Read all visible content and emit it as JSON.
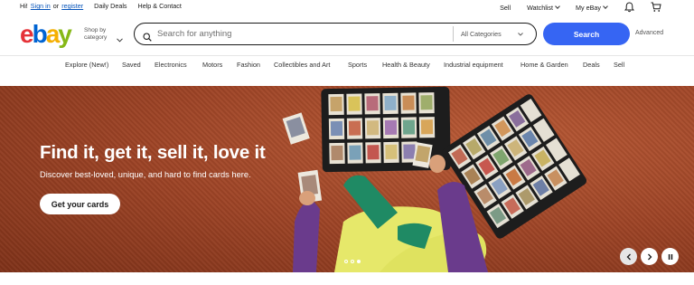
{
  "topbar": {
    "greeting_prefix": "Hi!",
    "sign_in": "Sign in",
    "or": "or",
    "register": "register",
    "daily_deals": "Daily Deals",
    "help_contact": "Help & Contact",
    "sell": "Sell",
    "watchlist": "Watchlist",
    "my_ebay": "My eBay"
  },
  "header": {
    "logo_letters": [
      "e",
      "b",
      "a",
      "y"
    ],
    "shop_by_category": "Shop by category",
    "search_placeholder": "Search for anything",
    "category_select": "All Categories",
    "search_button": "Search",
    "advanced": "Advanced"
  },
  "nav": {
    "items": [
      "Explore (New!)",
      "Saved",
      "Electronics",
      "Motors",
      "Fashion",
      "Collectibles and Art",
      "Sports",
      "Health & Beauty",
      "Industrial equipment",
      "Home & Garden",
      "Deals",
      "Sell"
    ]
  },
  "hero": {
    "title": "Find it, get it, sell it, love it",
    "subtitle": "Discover best-loved, unique, and hard to find cards here.",
    "cta": "Get your cards",
    "slide_count": 3,
    "active_slide": 3
  },
  "colors": {
    "primary_button": "#3665f3",
    "link": "#0654ba",
    "hero_background": "#9e4426"
  },
  "icons": [
    "search-icon",
    "bell-icon",
    "cart-icon",
    "chevron-down-icon",
    "chevron-left-icon",
    "chevron-right-icon",
    "pause-icon"
  ]
}
